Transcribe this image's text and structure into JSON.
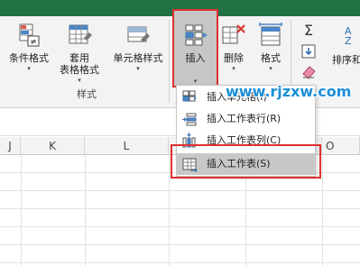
{
  "ribbon": {
    "conditional_format": "条件格式",
    "table_format_1": "套用",
    "table_format_2": "表格格式",
    "cell_styles": "单元格样式",
    "insert": "插入",
    "delete": "删除",
    "format": "格式",
    "sort_filter": "排序和",
    "styles_group": "样式",
    "dropdown_arrow": "▾"
  },
  "menu": {
    "items": [
      {
        "label": "插入单元格(I)",
        "icon": "insert-cells-icon"
      },
      {
        "label": "插入工作表行(R)",
        "icon": "insert-row-icon"
      },
      {
        "label": "插入工作表列(C)",
        "icon": "insert-column-icon"
      },
      {
        "label": "插入工作表(S)",
        "icon": "insert-sheet-icon"
      }
    ]
  },
  "columns": [
    "J",
    "K",
    "L",
    "M",
    "N",
    "O"
  ],
  "watermark": "www.rjzxw.com",
  "colors": {
    "excel_green": "#217346",
    "highlight_red": "#e0302f",
    "watermark_blue": "#1c8fd8"
  }
}
